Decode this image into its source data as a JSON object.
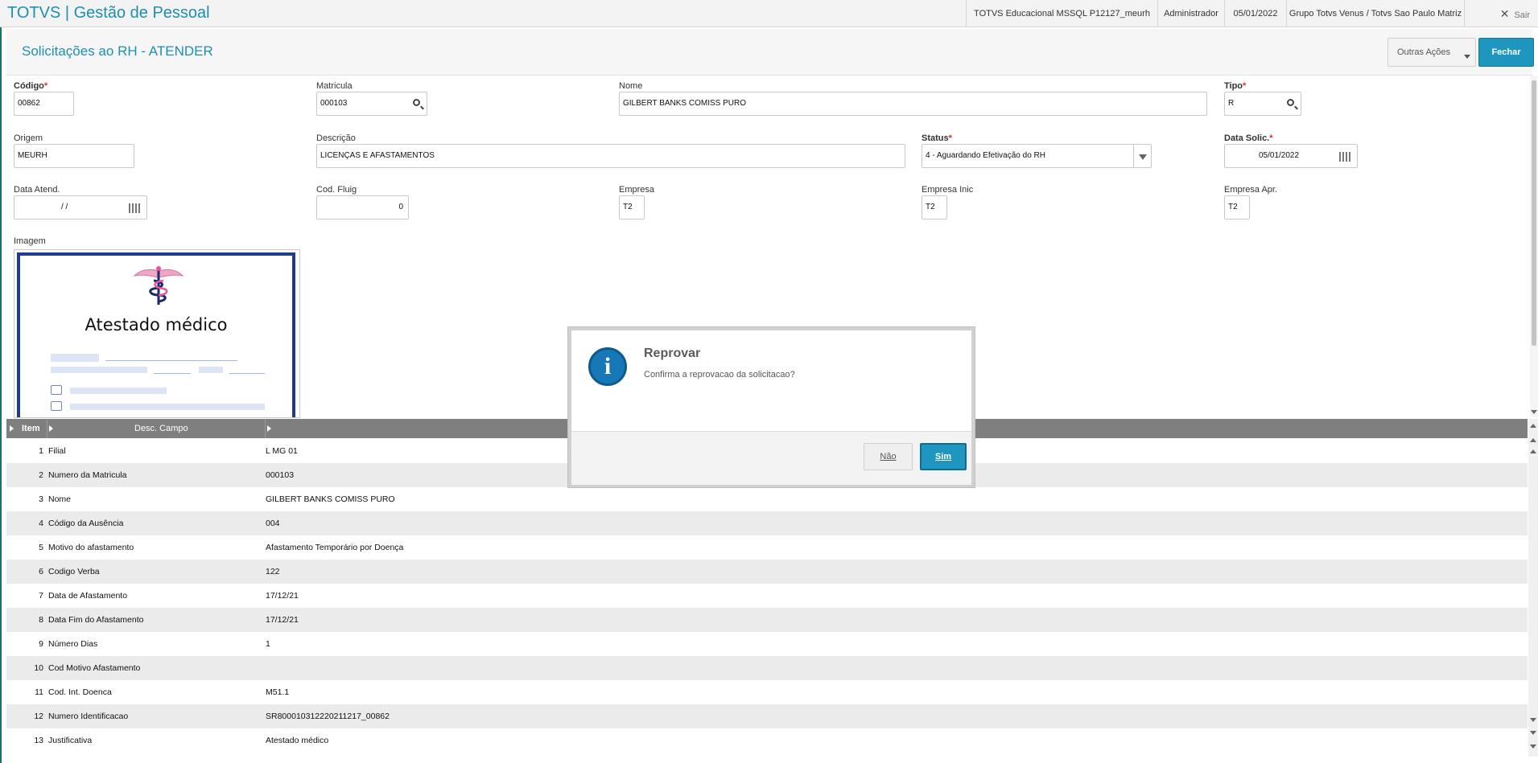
{
  "app": {
    "title": "TOTVS | Gestão de Pessoal",
    "environment": "TOTVS Educacional MSSQL P12127_meurh",
    "user": "Administrador",
    "date": "05/01/2022",
    "company": "Grupo Totvs Venus / Totvs Sao Paulo Matriz",
    "logout": "Sair"
  },
  "page": {
    "title": "Solicitações ao RH - ATENDER",
    "more_actions": "Outras Ações",
    "close": "Fechar"
  },
  "form": {
    "codigo": {
      "label": "Código",
      "value": "00862"
    },
    "matricula": {
      "label": "Matricula",
      "value": "000103"
    },
    "nome": {
      "label": "Nome",
      "value": "GILBERT BANKS COMISS PURO"
    },
    "tipo": {
      "label": "Tipo",
      "value": "R"
    },
    "origem": {
      "label": "Origem",
      "value": "MEURH"
    },
    "descricao": {
      "label": "Descrição",
      "value": "LICENÇAS E AFASTAMENTOS"
    },
    "status": {
      "label": "Status",
      "value": "4 - Aguardando Efetivação do RH"
    },
    "data_solic": {
      "label": "Data Solic.",
      "value": "05/01/2022"
    },
    "data_atend": {
      "label": "Data Atend.",
      "value": "/ /"
    },
    "cod_fluig": {
      "label": "Cod. Fluig",
      "value": "0"
    },
    "empresa": {
      "label": "Empresa",
      "value": "T2"
    },
    "empresa_inic": {
      "label": "Empresa Inic",
      "value": "T2"
    },
    "empresa_apr": {
      "label": "Empresa Apr.",
      "value": "T2"
    },
    "imagem": {
      "label": "Imagem",
      "doc_title": "Atestado médico"
    }
  },
  "grid": {
    "headers": {
      "item": "Item",
      "desc": "Desc. Campo"
    },
    "rows": [
      {
        "item": "1",
        "campo": "Filial",
        "valor": "L MG 01"
      },
      {
        "item": "2",
        "campo": "Numero da Matricula",
        "valor": "000103"
      },
      {
        "item": "3",
        "campo": "Nome",
        "valor": "GILBERT BANKS COMISS PURO"
      },
      {
        "item": "4",
        "campo": "Código da Ausência",
        "valor": "004"
      },
      {
        "item": "5",
        "campo": "Motivo do afastamento",
        "valor": "Afastamento Temporário por Doença"
      },
      {
        "item": "6",
        "campo": "Codigo Verba",
        "valor": "122"
      },
      {
        "item": "7",
        "campo": "Data de Afastamento",
        "valor": "17/12/21"
      },
      {
        "item": "8",
        "campo": "Data Fim do Afastamento",
        "valor": "17/12/21"
      },
      {
        "item": "9",
        "campo": "Número Dias",
        "valor": "1"
      },
      {
        "item": "10",
        "campo": "Cod Motivo Afastamento",
        "valor": ""
      },
      {
        "item": "11",
        "campo": "Cod. Int. Doenca",
        "valor": "M51.1"
      },
      {
        "item": "12",
        "campo": "Numero Identificacao",
        "valor": "SR800010312220211217_00862"
      },
      {
        "item": "13",
        "campo": "Justificativa",
        "valor": "Atestado médico"
      }
    ]
  },
  "dialog": {
    "title": "Reprovar",
    "message": "Confirma a reprovacao da solicitacao?",
    "no": "Não",
    "yes": "Sim",
    "icon": "info-icon"
  }
}
